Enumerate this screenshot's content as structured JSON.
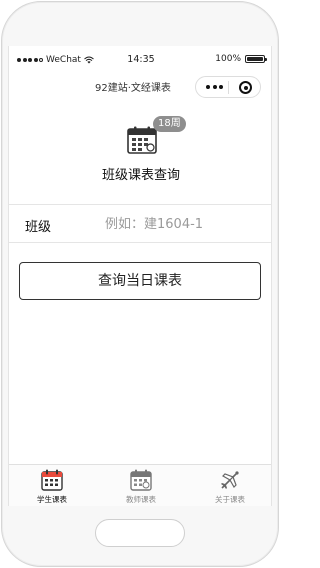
{
  "status_bar": {
    "carrier": "WeChat",
    "time": "14:35",
    "battery_text": "100%",
    "battery_level": 1.0
  },
  "nav": {
    "title": "92建站·文经课表",
    "more_icon": "more-dots-icon",
    "close_icon": "target-circle-icon"
  },
  "header": {
    "icon": "calendar-icon",
    "week_badge": "18周",
    "heading": "班级课表查询"
  },
  "form": {
    "class_label": "班级",
    "class_placeholder": "例如：建1604-1",
    "class_value": "",
    "submit_label": "查询当日课表"
  },
  "tabs": [
    {
      "label": "学生课表",
      "icon": "student-calendar-icon",
      "active": true
    },
    {
      "label": "教师课表",
      "icon": "teacher-calendar-icon",
      "active": false
    },
    {
      "label": "关于课表",
      "icon": "airplane-icon",
      "active": false
    }
  ],
  "colors": {
    "accent_red": "#e94b3c",
    "badge_gray": "#8e8e8e",
    "border": "#333333"
  }
}
